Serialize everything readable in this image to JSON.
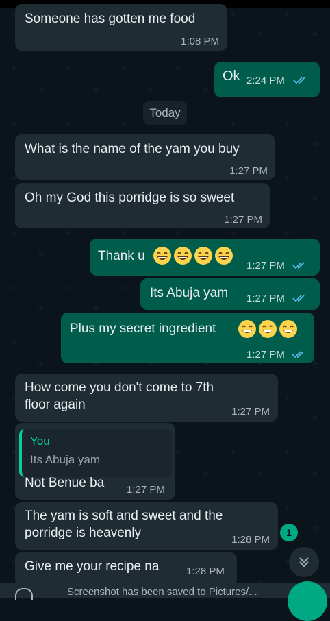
{
  "messages": [
    {
      "id": "m1",
      "dir": "in",
      "text": "Someone has gotten me food",
      "time": "1:08 PM"
    },
    {
      "id": "m2",
      "dir": "out",
      "text": "Ok",
      "time": "2:24 PM",
      "read": true
    },
    {
      "id": "day",
      "label": "Today"
    },
    {
      "id": "m3",
      "dir": "in",
      "text": "What is the name of the yam you buy",
      "time": "1:27 PM"
    },
    {
      "id": "m4",
      "dir": "in",
      "text": "Oh my God this porridge is so sweet",
      "time": "1:27 PM"
    },
    {
      "id": "m5",
      "dir": "out",
      "text": "Thank u",
      "emoji_count": 4,
      "time": "1:27 PM",
      "read": true
    },
    {
      "id": "m6",
      "dir": "out",
      "text": "Its Abuja yam",
      "time": "1:27 PM",
      "read": true
    },
    {
      "id": "m7",
      "dir": "out",
      "text": "Plus my secret ingredient",
      "emoji_count": 3,
      "time": "1:27 PM",
      "read": true
    },
    {
      "id": "m8",
      "dir": "in",
      "line1": "How come you don't come to 7th",
      "line2": "floor again",
      "time": "1:27 PM"
    },
    {
      "id": "m9",
      "dir": "in",
      "reply": {
        "name": "You",
        "text": "Its Abuja yam"
      },
      "text": "Not Benue ba",
      "time": "1:27 PM"
    },
    {
      "id": "m10",
      "dir": "in",
      "line1": "The yam is soft and sweet and the",
      "line2": "porridge is heavenly",
      "time": "1:28 PM"
    },
    {
      "id": "m11",
      "dir": "in",
      "text": "Give me your recipe na",
      "time": "1:28 PM"
    }
  ],
  "unread_count": "1",
  "toast": "Screenshot has been saved to Pictures/...",
  "icons": {
    "read_ticks": "double-check-icon",
    "scroll": "chevrons-down-icon",
    "emoji": "grinning-face-icon"
  },
  "colors": {
    "incoming": "#202c33",
    "outgoing": "#005c4b",
    "accent": "#00a884",
    "tick": "#53bdeb",
    "background": "#0b141a"
  }
}
